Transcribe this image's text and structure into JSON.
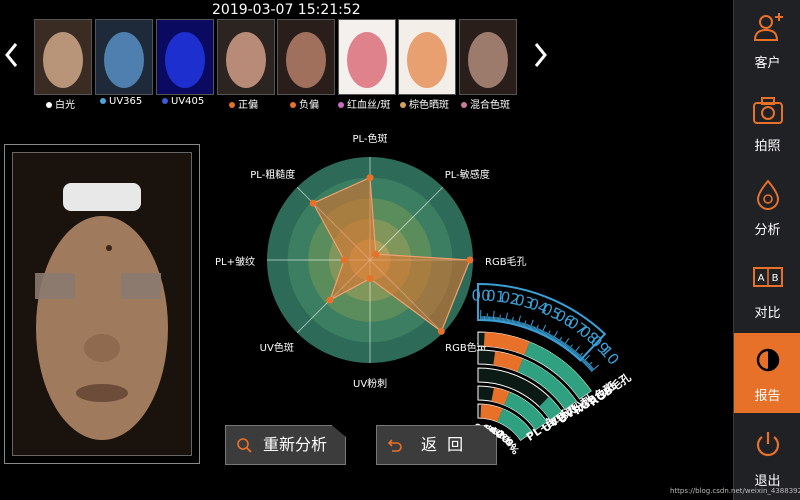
{
  "timestamp": "2019-03-07 15:21:52",
  "thumbnails": [
    {
      "label": "白光",
      "dot": "#ffffff",
      "tint": "#b89478"
    },
    {
      "label": "UV365",
      "dot": "#4aa3df",
      "tint": "#4f7fae"
    },
    {
      "label": "UV405",
      "dot": "#3b5bdb",
      "tint": "#1e2fd0"
    },
    {
      "label": "正偏",
      "dot": "#e8712a",
      "tint": "#b88a78"
    },
    {
      "label": "负偏",
      "dot": "#e8712a",
      "tint": "#a0705c"
    },
    {
      "label": "红血丝/斑",
      "dot": "#c86cc8",
      "tint": "#e0828c"
    },
    {
      "label": "棕色晒斑",
      "dot": "#d4a05a",
      "tint": "#e8a070"
    },
    {
      "label": "混合色斑",
      "dot": "#c87c9c",
      "tint": "#9c7a6c"
    }
  ],
  "radar": {
    "axes": [
      "PL-色斑",
      "PL-敏感度",
      "RGB毛孔",
      "RGB色斑",
      "UV粉刺",
      "UV色斑",
      "PL+皱纹",
      "PL-粗糙度"
    ],
    "values": [
      0.8,
      0.08,
      0.97,
      0.98,
      0.18,
      0.55,
      0.25,
      0.78
    ]
  },
  "gauge": {
    "percent_labels": [
      "100%",
      "80%",
      "60%",
      "40%",
      "20%",
      "0%"
    ],
    "series": [
      {
        "name": "PL+皱纹",
        "value": 0.95
      },
      {
        "name": "UV色斑",
        "value": 0.8
      },
      {
        "name": "UV粉刺",
        "value": 0.2
      },
      {
        "name": "RGB色斑",
        "value": 0.85
      },
      {
        "name": "RGB毛孔",
        "value": 0.95
      }
    ],
    "scale_labels": [
      "00",
      "01",
      "02",
      "03",
      "04",
      "05",
      "06",
      "07",
      "08",
      "09",
      "10"
    ]
  },
  "buttons": {
    "reanalyze": "重新分析",
    "back": "返  回"
  },
  "sidebar": {
    "items": [
      {
        "label": "客户",
        "active": false
      },
      {
        "label": "拍照",
        "active": false
      },
      {
        "label": "分析",
        "active": false
      },
      {
        "label": "对比",
        "active": false
      },
      {
        "label": "报告",
        "active": true
      },
      {
        "label": "退出",
        "active": false
      }
    ],
    "compare_icon_text": [
      "A",
      "B"
    ]
  },
  "watermark": "https://blog.csdn.net/weixin_43883929",
  "colors": {
    "accent": "#e8712a",
    "teal": "#2fa080",
    "scale_blue": "#3aa0d6"
  }
}
